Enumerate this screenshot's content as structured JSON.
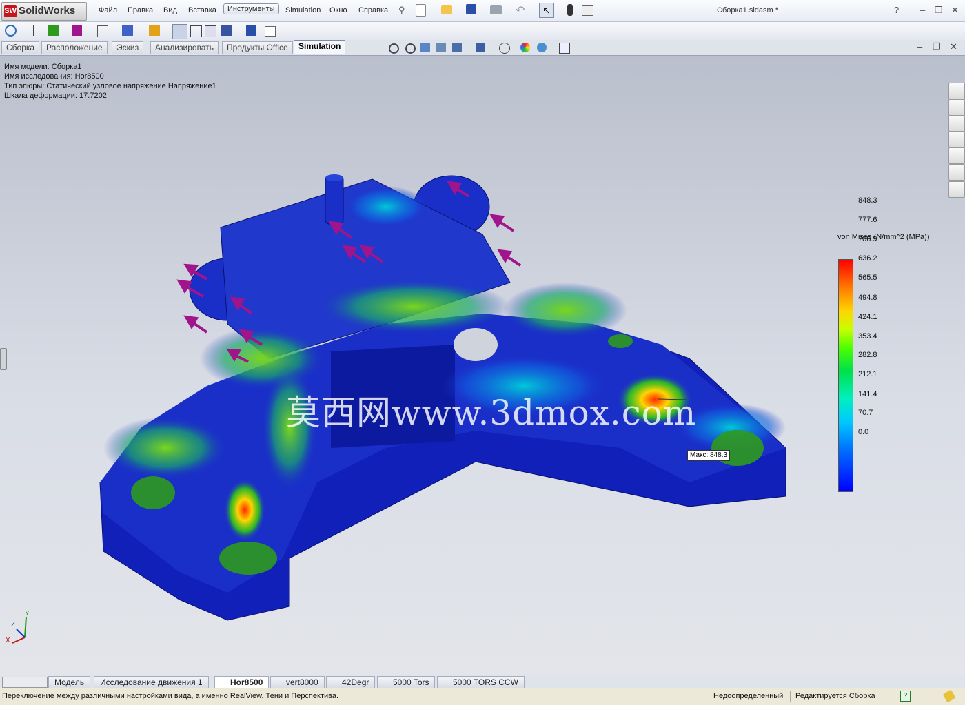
{
  "app": {
    "logo_text": "SolidWorks",
    "logo_badge": "SW",
    "document_title": "Сборка1.sldasm *"
  },
  "menu": [
    "Файл",
    "Правка",
    "Вид",
    "Вставка",
    "Инструменты",
    "Simulation",
    "Окно",
    "Справка"
  ],
  "tabs": [
    {
      "label": "Сборка"
    },
    {
      "label": "Расположение"
    },
    {
      "label": "Эскиз"
    },
    {
      "label": "Анализировать"
    },
    {
      "label": "Продукты Office"
    },
    {
      "label": "Simulation"
    }
  ],
  "info": {
    "model": "Имя модели: Сборка1",
    "study": "Имя  исследования: Hor8500",
    "plot_type": "Тип эпюры: Статический узловое напряжение Напряжение1",
    "deform_scale": "Шкала деформации: 17.7202"
  },
  "legend": {
    "title": "von Mises (N/mm^2 (MPa))",
    "values": [
      "848.3",
      "777.6",
      "706.9",
      "636.2",
      "565.5",
      "494.8",
      "424.1",
      "353.4",
      "282.8",
      "212.1",
      "141.4",
      "70.7",
      "0.0"
    ]
  },
  "max_label": "Макс: 848.3",
  "watermark": "莫西网www.3dmox.com",
  "axes": {
    "x": "X",
    "y": "Y",
    "z": "Z"
  },
  "bottom_tabs": [
    "Модель",
    "Исследование движения 1",
    "Hor8500",
    "vert8000",
    "42Degr",
    "5000 Tors",
    "5000 TORS CCW"
  ],
  "status": {
    "message": "Переключение между различными настройками вида, а именно RealView, Тени и Перспектива.",
    "state": "Недоопределенный",
    "mode": "Редактируется Сборка",
    "help": "?"
  },
  "window_buttons": {
    "help": "?",
    "minimize": "–",
    "restore": "❐",
    "close": "✕"
  },
  "colors": {
    "accent": "#c8141c",
    "model_blue": "#1a2fc8",
    "arrow": "#a0148c",
    "fixture": "#2f9a1e"
  }
}
